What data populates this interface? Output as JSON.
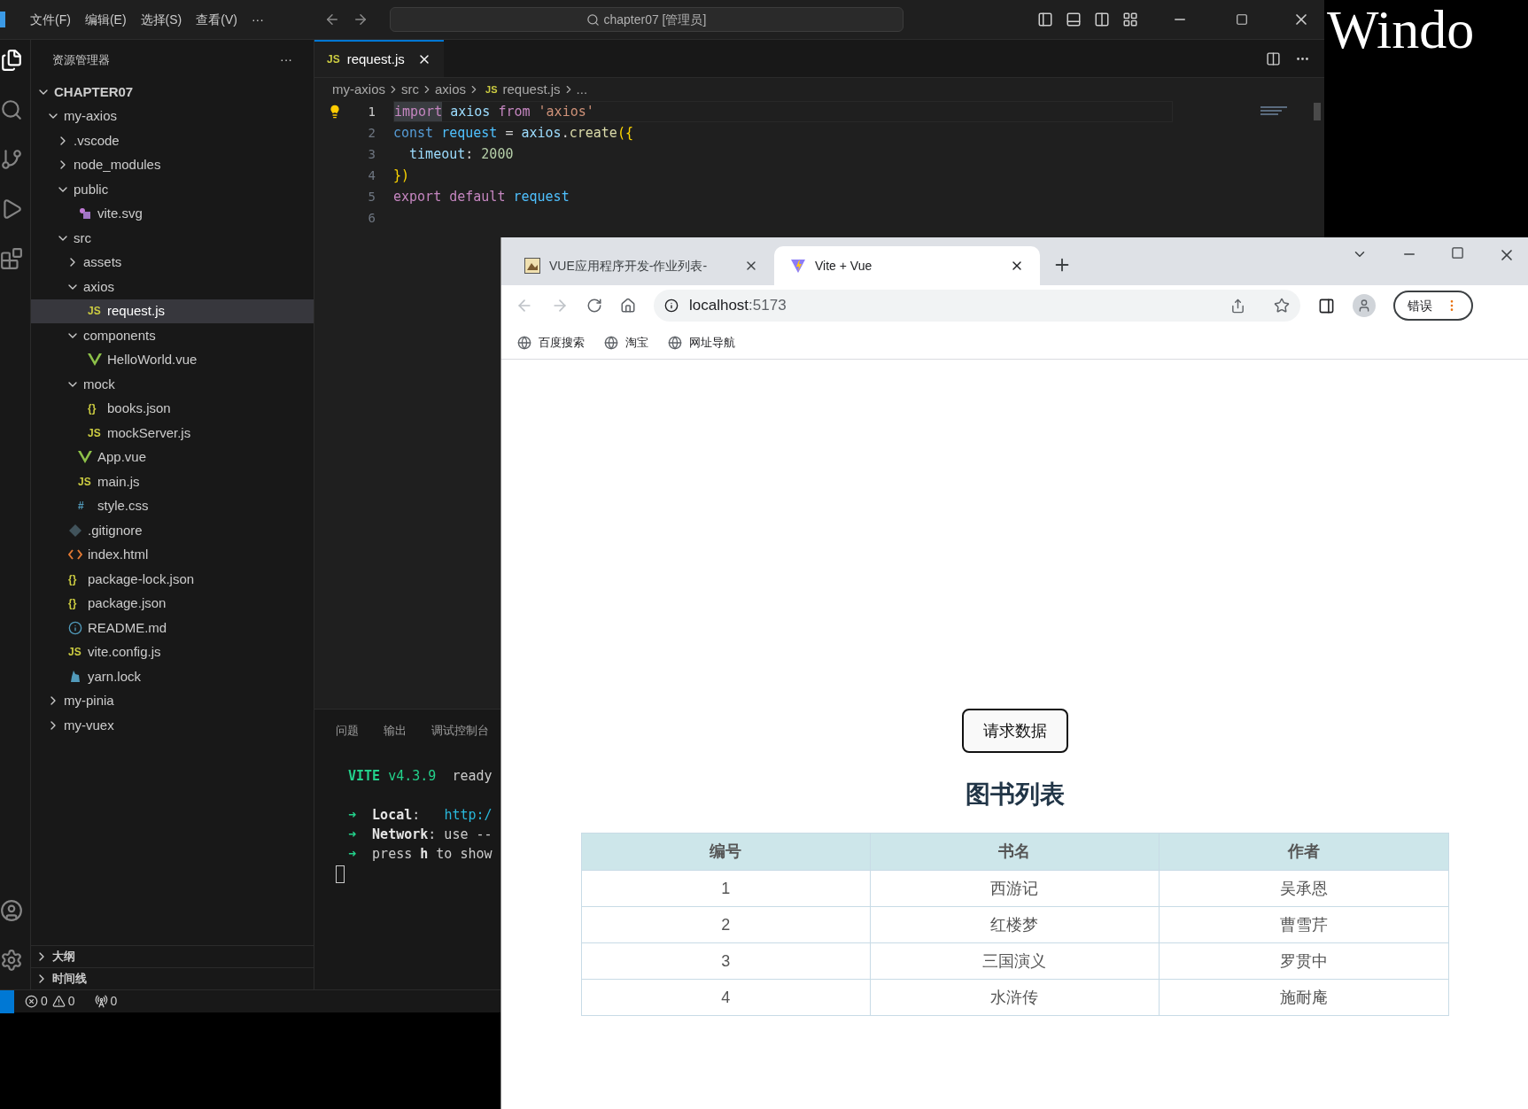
{
  "vscode": {
    "menu": [
      "文件(F)",
      "编辑(E)",
      "选择(S)",
      "查看(V)",
      "···"
    ],
    "search": "chapter07 [管理员]",
    "explorer": {
      "title": "资源管理器",
      "more": "···",
      "root": {
        "label": "CHAPTER07",
        "kind": "folder",
        "expanded": true,
        "selected": false,
        "children": [
          {
            "label": "my-axios",
            "kind": "folder",
            "expanded": true,
            "selected": false,
            "children": [
              {
                "label": ".vscode",
                "kind": "folder",
                "expanded": false,
                "selected": false
              },
              {
                "label": "node_modules",
                "kind": "folder",
                "expanded": false,
                "selected": false
              },
              {
                "label": "public",
                "kind": "folder",
                "expanded": true,
                "selected": false,
                "children": [
                  {
                    "label": "vite.svg",
                    "kind": "svg",
                    "selected": false
                  }
                ]
              },
              {
                "label": "src",
                "kind": "folder",
                "expanded": true,
                "selected": false,
                "children": [
                  {
                    "label": "assets",
                    "kind": "folder",
                    "expanded": false,
                    "selected": false
                  },
                  {
                    "label": "axios",
                    "kind": "folder",
                    "expanded": true,
                    "selected": false,
                    "children": [
                      {
                        "label": "request.js",
                        "kind": "js",
                        "glyph": "JS",
                        "selected": true
                      }
                    ]
                  },
                  {
                    "label": "components",
                    "kind": "folder",
                    "expanded": true,
                    "selected": false,
                    "children": [
                      {
                        "label": "HelloWorld.vue",
                        "kind": "vue",
                        "selected": false
                      }
                    ]
                  },
                  {
                    "label": "mock",
                    "kind": "folder",
                    "expanded": true,
                    "selected": false,
                    "children": [
                      {
                        "label": "books.json",
                        "kind": "json",
                        "glyph": "{}",
                        "selected": false
                      },
                      {
                        "label": "mockServer.js",
                        "kind": "js",
                        "glyph": "JS",
                        "selected": false
                      }
                    ]
                  },
                  {
                    "label": "App.vue",
                    "kind": "vue",
                    "selected": false
                  },
                  {
                    "label": "main.js",
                    "kind": "js",
                    "glyph": "JS",
                    "selected": false
                  },
                  {
                    "label": "style.css",
                    "kind": "css",
                    "glyph": "#",
                    "selected": false
                  }
                ]
              },
              {
                "label": ".gitignore",
                "kind": "git",
                "selected": false
              },
              {
                "label": "index.html",
                "kind": "html",
                "selected": false
              },
              {
                "label": "package-lock.json",
                "kind": "json",
                "glyph": "{}",
                "selected": false
              },
              {
                "label": "package.json",
                "kind": "json",
                "glyph": "{}",
                "selected": false
              },
              {
                "label": "README.md",
                "kind": "readme",
                "selected": false
              },
              {
                "label": "vite.config.js",
                "kind": "js",
                "glyph": "JS",
                "selected": false
              },
              {
                "label": "yarn.lock",
                "kind": "yarn",
                "selected": false
              }
            ]
          },
          {
            "label": "my-pinia",
            "kind": "folder",
            "expanded": false,
            "selected": false
          },
          {
            "label": "my-vuex",
            "kind": "folder",
            "expanded": false,
            "selected": false
          }
        ]
      }
    },
    "sections": [
      {
        "label": "大纲",
        "expanded": false
      },
      {
        "label": "时间线",
        "expanded": false
      }
    ],
    "editor_tab": {
      "label": "request.js",
      "glyph": "JS"
    },
    "breadcrumb": [
      {
        "label": "my-axios"
      },
      {
        "label": "src"
      },
      {
        "label": "axios"
      },
      {
        "label": "request.js",
        "glyph": "JS"
      },
      {
        "label": "..."
      }
    ],
    "code": [
      {
        "number": "1",
        "active": true,
        "lightbulb": true,
        "tokens": [
          {
            "text": "import",
            "kind": "control",
            "highlighted": true
          },
          {
            "text": " axios ",
            "kind": "variable",
            "highlighted": false
          },
          {
            "text": "from",
            "kind": "control",
            "highlighted": false
          },
          {
            "text": " 'axios'",
            "kind": "string",
            "highlighted": false
          }
        ]
      },
      {
        "number": "2",
        "active": false,
        "lightbulb": false,
        "tokens": [
          {
            "text": "const",
            "kind": "keyword",
            "highlighted": false
          },
          {
            "text": " request",
            "kind": "constant",
            "highlighted": false
          },
          {
            "text": " = ",
            "kind": "plain",
            "highlighted": false
          },
          {
            "text": "axios",
            "kind": "variable",
            "highlighted": false
          },
          {
            "text": ".",
            "kind": "plain",
            "highlighted": false
          },
          {
            "text": "create",
            "kind": "function",
            "highlighted": false
          },
          {
            "text": "({",
            "kind": "bracket",
            "highlighted": false
          }
        ]
      },
      {
        "number": "3",
        "active": false,
        "lightbulb": false,
        "tokens": [
          {
            "text": "  timeout",
            "kind": "variable",
            "highlighted": false
          },
          {
            "text": ": ",
            "kind": "plain",
            "highlighted": false
          },
          {
            "text": "2000",
            "kind": "number",
            "highlighted": false
          }
        ]
      },
      {
        "number": "4",
        "active": false,
        "lightbulb": false,
        "tokens": [
          {
            "text": "})",
            "kind": "bracket",
            "highlighted": false
          }
        ]
      },
      {
        "number": "5",
        "active": false,
        "lightbulb": false,
        "tokens": [
          {
            "text": "export",
            "kind": "control",
            "highlighted": false
          },
          {
            "text": " default",
            "kind": "control",
            "highlighted": false
          },
          {
            "text": " request",
            "kind": "constant",
            "highlighted": false
          }
        ]
      },
      {
        "number": "6",
        "active": false,
        "lightbulb": false
      }
    ],
    "panel_tabs": [
      "问题",
      "输出",
      "调试控制台"
    ],
    "terminal": [
      {
        "kind": "banner",
        "tokens": [
          {
            "text": "VITE",
            "kind": "brand"
          },
          {
            "text": " v4.3.9",
            "kind": "version"
          },
          {
            "text": "  ready",
            "kind": "plain"
          }
        ]
      },
      {
        "kind": "line",
        "tokens": [
          {
            "text": "➜",
            "kind": "arrow"
          },
          {
            "text": "  Local",
            "kind": "bold"
          },
          {
            "text": ":   ",
            "kind": "plain"
          },
          {
            "text": "http:/",
            "kind": "link"
          }
        ]
      },
      {
        "kind": "line",
        "tokens": [
          {
            "text": "➜",
            "kind": "arrow"
          },
          {
            "text": "  Network",
            "kind": "bold"
          },
          {
            "text": ": use --",
            "kind": "plain"
          }
        ]
      },
      {
        "kind": "line",
        "tokens": [
          {
            "text": "➜",
            "kind": "arrow"
          },
          {
            "text": "  press ",
            "kind": "plain"
          },
          {
            "text": "h",
            "kind": "bold"
          },
          {
            "text": " to show",
            "kind": "plain"
          }
        ]
      }
    ],
    "status": {
      "errors": "0",
      "warnings": "0",
      "ports": "0"
    }
  },
  "backdrop_text": "Windo",
  "browser": {
    "tabs": [
      {
        "title": "VUE应用程序开发-作业列表-",
        "kind": "page",
        "selected": false
      },
      {
        "title": "Vite + Vue",
        "kind": "vite",
        "selected": true
      }
    ],
    "address": {
      "host": "localhost",
      "port": ":5173"
    },
    "profile": "错误",
    "bookmarks": [
      "百度搜索",
      "淘宝",
      "网址导航"
    ],
    "page": {
      "button": "请求数据",
      "heading": "图书列表",
      "table": {
        "columns": [
          "编号",
          "书名",
          "作者"
        ],
        "rows": [
          [
            "1",
            "西游记",
            "吴承恩"
          ],
          [
            "2",
            "红楼梦",
            "曹雪芹"
          ],
          [
            "3",
            "三国演义",
            "罗贯中"
          ],
          [
            "4",
            "水浒传",
            "施耐庵"
          ]
        ]
      }
    }
  }
}
